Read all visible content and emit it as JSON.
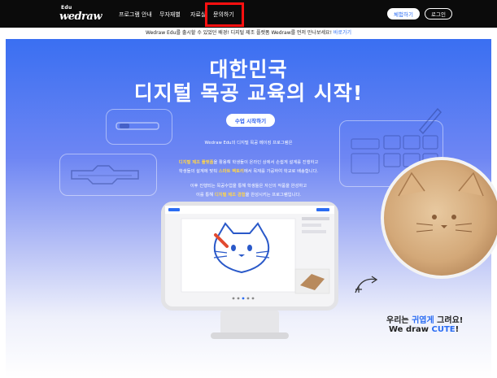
{
  "nav": {
    "logo_top": "Edu",
    "logo_main": "wedraw",
    "items": [
      "프로그램 안내",
      "무자재별",
      "자료실",
      "문의하기"
    ],
    "signup_label": "체험하기",
    "login_label": "로그인"
  },
  "notice": {
    "text": "Wedraw Edu를 출시할 수 있었던 배경! 디지털 제조 플랫폼 Wedraw를 먼저 만나보세요!",
    "link_label": "바로가기"
  },
  "hero": {
    "title_line1": "대한민국",
    "title_line2": "디지털 목공 교육의 시작!",
    "cta_label": "수업 시작하기",
    "intro": "Wedraw Edu의 디지털 목공 메이킹 프로그램은",
    "p1_hl1": "디지털 제조 플랫폼",
    "p1_rest": "을 활용해 학생들이 온라인 상에서 손쉽게 설계를 진행하고",
    "p2_pre": "학생들의 설계에 맞춰 ",
    "p2_hl": "스마트 팩토리",
    "p2_rest": "에서 목재를 가공하여 학교로 배송합니다.",
    "p3": "이후 진행되는 목공수업을 통해 학생들은 자신의 작품을 완성하고",
    "p4_pre": "이를 통해 ",
    "p4_hl": "디지털 제조 경험",
    "p4_rest": "을 완성시키는 프로그램입니다."
  },
  "caption": {
    "line1_pre": "우리는 ",
    "line1_accent": "귀엽게",
    "line1_post": " 그려요!",
    "line2_pre": "We draw ",
    "line2_accent": "CUTE",
    "line2_post": "!"
  },
  "colors": {
    "accent": "#2a6cf3",
    "highlight": "#ffd54a",
    "nav_bg": "#0b0b0b",
    "annotation_red": "#ff1010"
  }
}
